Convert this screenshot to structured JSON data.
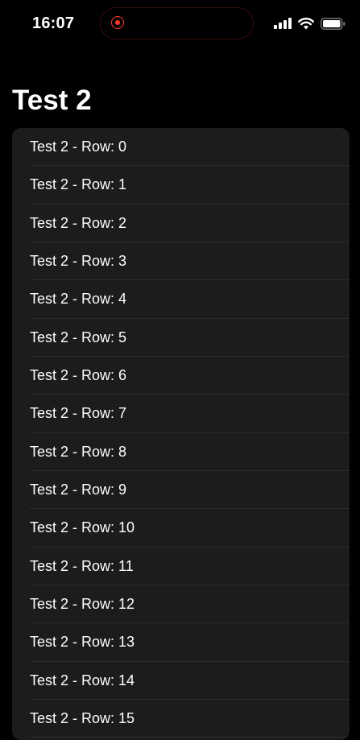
{
  "status_bar": {
    "time": "16:07"
  },
  "icons": {
    "recording": "recording-indicator-icon",
    "signal": "cellular-signal-icon",
    "wifi": "wifi-icon",
    "battery": "battery-icon"
  },
  "colors": {
    "background": "#000000",
    "list_background": "#1c1c1e",
    "separator": "#2c2c2e",
    "recording": "#ff3b30"
  },
  "title": "Test 2",
  "rows": [
    "Test 2 - Row: 0",
    "Test 2 - Row: 1",
    "Test 2 - Row: 2",
    "Test 2 - Row: 3",
    "Test 2 - Row: 4",
    "Test 2 - Row: 5",
    "Test 2 - Row: 6",
    "Test 2 - Row: 7",
    "Test 2 - Row: 8",
    "Test 2 - Row: 9",
    "Test 2 - Row: 10",
    "Test 2 - Row: 11",
    "Test 2 - Row: 12",
    "Test 2 - Row: 13",
    "Test 2 - Row: 14",
    "Test 2 - Row: 15"
  ]
}
